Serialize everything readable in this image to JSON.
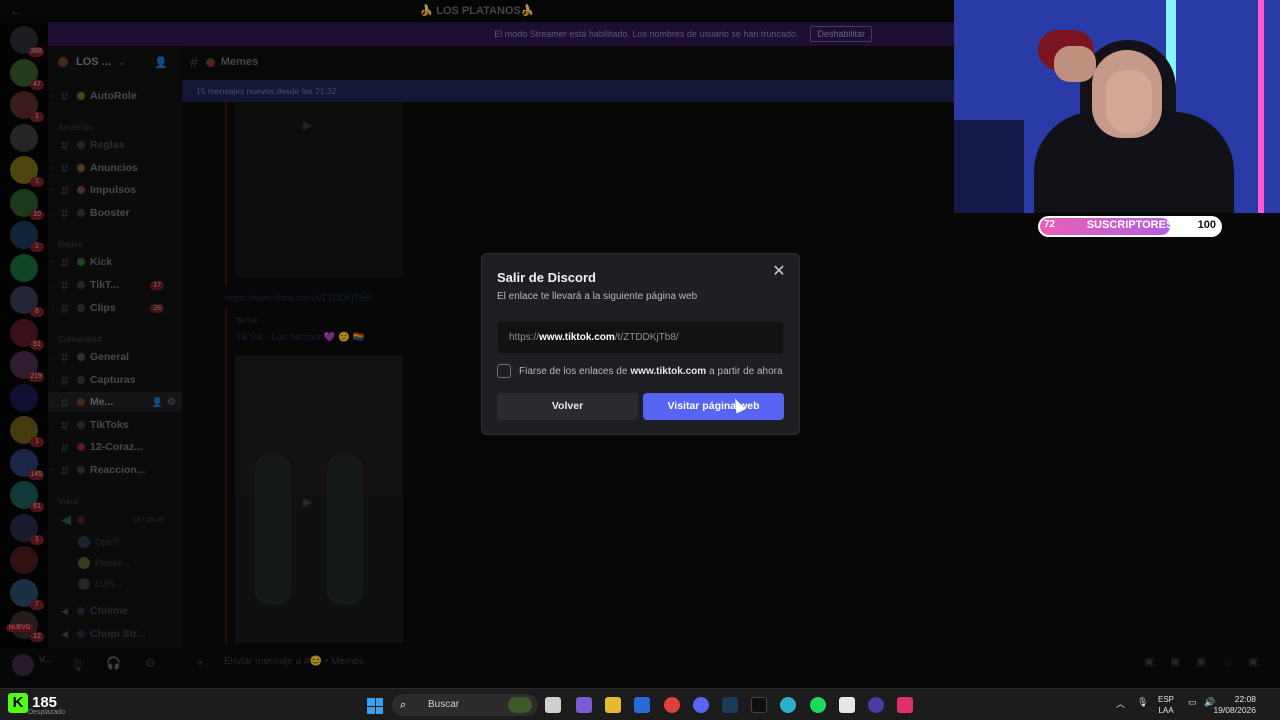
{
  "window": {
    "title": "🍌 LOS PLATANOS🍌",
    "streamer_notice": "El modo Streamer está habilitado. Los nombres de usuario se han truncado.",
    "streamer_disable": "Deshabilitar"
  },
  "servers": [
    {
      "badge": "368"
    },
    {
      "badge": "47"
    },
    {
      "badge": "1"
    },
    {
      "badge": ""
    },
    {
      "badge": "1"
    },
    {
      "badge": "10"
    },
    {
      "badge": "1"
    },
    {
      "badge": ""
    },
    {
      "badge": "8"
    },
    {
      "badge": "51"
    },
    {
      "badge": "219"
    },
    {
      "badge": ""
    },
    {
      "badge": "1"
    },
    {
      "badge": "145"
    },
    {
      "badge": "61"
    },
    {
      "badge": "1"
    },
    {
      "badge": ""
    },
    {
      "badge": "7"
    },
    {
      "badge": "12"
    }
  ],
  "server_nuevo": "NUEVO",
  "sidebar": {
    "server_name": "LOS ...",
    "categories": {
      "anuncios": "Anuncios",
      "redes": "Redes",
      "comunidad": "Comunidad",
      "voice": "Voice"
    },
    "channels": {
      "autorole": "AutoRole",
      "reglas": "Reglas",
      "anuncios": "Anuncios",
      "impulsos": "Impulsos",
      "booster": "Booster",
      "kick": "Kick",
      "tiktok": "TikT...",
      "tiktok_badge": "17",
      "clips": "Clips",
      "clips_badge": "28",
      "general": "General",
      "capturas": "Capturas",
      "memes": "Me...",
      "tiktoks": "TikToks",
      "corazones": "12-Coraz...",
      "reacciones": "Reaccion...",
      "voice_time": "187:28:46",
      "voice_user1": "Ops?!",
      "voice_user2": "Platani...",
      "voice_user3": "LUIS...",
      "chisme": "Chisme",
      "chupi": "Chupi Str..."
    },
    "user_name": "V...",
    "user_status": "Desplazando"
  },
  "chat": {
    "channel_name": "Memes",
    "new_messages": "15 mensajes nuevos desde las 21:32",
    "link": "https://www.tiktok.com/t/ZTDDKjTb8/",
    "embed_source": "TikTok",
    "embed_title": "TikTok · Los hercruz 💜 🙂 🏳️‍🌈",
    "composer_placeholder": "Enviar mensaje a #😊 • Memes"
  },
  "modal": {
    "title": "Salir de Discord",
    "subtitle": "El enlace te llevará a la siguiente página web",
    "url_prefix": "https://",
    "url_domain": "www.tiktok.com",
    "url_path": "/t/ZTDDKjTb8/",
    "trust_prefix": "Fiarse de los enlaces de",
    "trust_domain": "www.tiktok.com",
    "trust_suffix": "a partir de ahora",
    "trust_checked": false,
    "back_label": "Volver",
    "visit_label": "Visitar página web"
  },
  "overlay": {
    "subs_current": "72",
    "subs_label": "SUSCRIPTORES",
    "subs_goal": "100",
    "subs_fraction": 0.72
  },
  "taskbar": {
    "kick_count": "185",
    "kick_status": "Desplazado",
    "search_placeholder": "Buscar",
    "lang_line1": "ESP",
    "lang_line2": "LAA",
    "time": "22:08",
    "date": "19/08/2026"
  },
  "colors": {
    "blurple": "#5865f2",
    "streamer_banner": "#2d1650",
    "kick_green": "#53fc18"
  }
}
